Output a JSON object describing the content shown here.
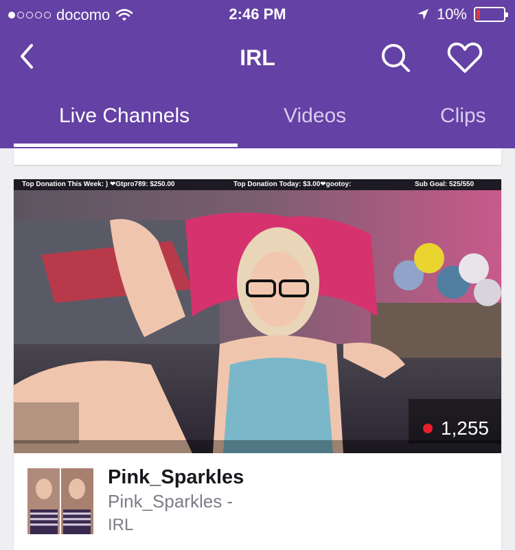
{
  "status_bar": {
    "carrier": "docomo",
    "time": "2:46 PM",
    "battery": "10%"
  },
  "header": {
    "title": "IRL"
  },
  "tabs": [
    {
      "label": "Live Channels",
      "active": true
    },
    {
      "label": "Videos",
      "active": false
    },
    {
      "label": "Clips",
      "active": false
    }
  ],
  "stream": {
    "overlay": {
      "top_week": "Top Donation This Week: ) ❤Gtpro789: $250.00",
      "top_today": "Top Donation Today: $3.00❤gootoy:",
      "sub_goal": "Sub Goal: 525/550"
    },
    "viewer_count": "1,255",
    "channel_name": "Pink_Sparkles",
    "status_title": "Pink_Sparkles -",
    "game": "IRL"
  },
  "colors": {
    "brand": "#6441a4",
    "live": "#ec1c2c"
  }
}
